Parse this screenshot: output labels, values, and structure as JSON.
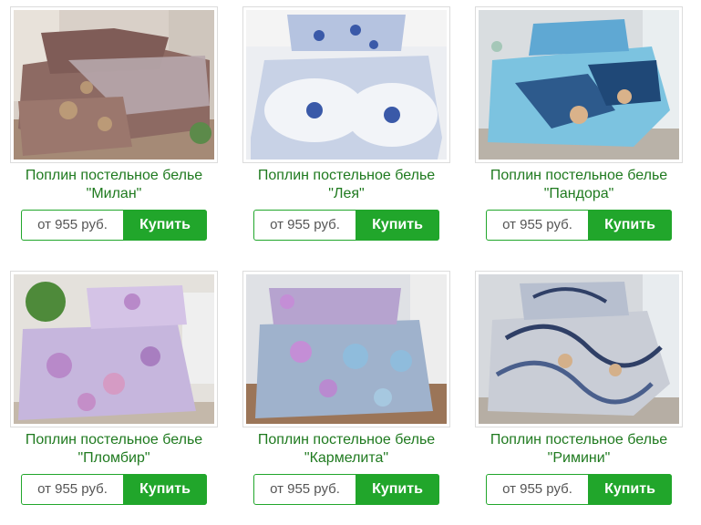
{
  "products": [
    {
      "title_line1": "Поплин постельное белье",
      "title_line2": "\"Милан\"",
      "price": "от 955 руб.",
      "buy_label": "Купить",
      "image": "bedding-milan-photo"
    },
    {
      "title_line1": "Поплин постельное белье",
      "title_line2": "\"Лея\"",
      "price": "от 955 руб.",
      "buy_label": "Купить",
      "image": "bedding-leya-photo"
    },
    {
      "title_line1": "Поплин постельное белье",
      "title_line2": "\"Пандора\"",
      "price": "от 955 руб.",
      "buy_label": "Купить",
      "image": "bedding-pandora-photo"
    },
    {
      "title_line1": "Поплин постельное белье",
      "title_line2": "\"Пломбир\"",
      "price": "от 955 руб.",
      "buy_label": "Купить",
      "image": "bedding-plombir-photo"
    },
    {
      "title_line1": "Поплин постельное белье",
      "title_line2": "\"Кармелита\"",
      "price": "от 955 руб.",
      "buy_label": "Купить",
      "image": "bedding-karmelita-photo"
    },
    {
      "title_line1": "Поплин постельное белье",
      "title_line2": "\"Римини\"",
      "price": "от 955 руб.",
      "buy_label": "Купить",
      "image": "bedding-rimini-photo"
    }
  ],
  "colors": {
    "accent": "#21a62b",
    "title": "#1f7a1f",
    "price_text": "#555555",
    "border": "#dcdcdc"
  }
}
